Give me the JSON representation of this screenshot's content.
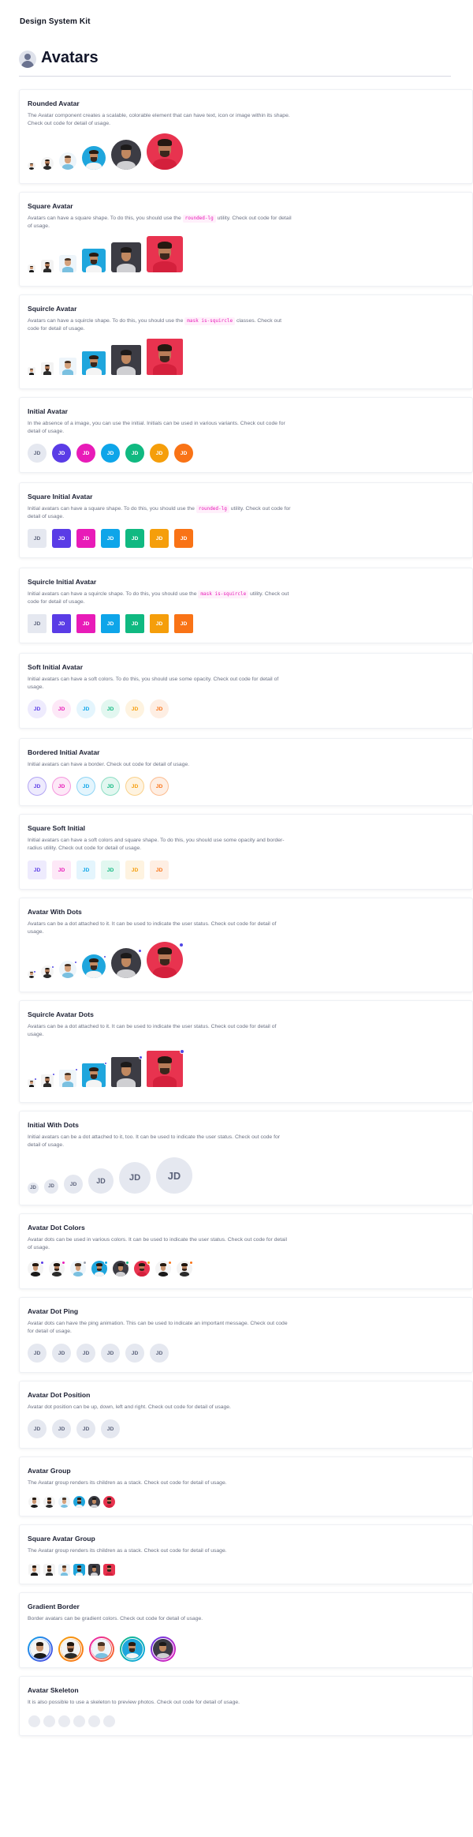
{
  "kit_title": "Design System Kit",
  "page_title": "Avatars",
  "initials": "JD",
  "colors": {
    "indigo": "#5a3ce6",
    "pink": "#e81bb8",
    "sky": "#0ea5e9",
    "green": "#10b981",
    "amber": "#f59e0b",
    "orange": "#f97316",
    "neutral": "#e5e8f0",
    "dot": "#4f46e5"
  },
  "sections": {
    "rounded": {
      "title": "Rounded Avatar",
      "desc": "The Avatar component creates a scalable, colorable element that can have text, icon or image within its shape. Check out code for detail of usage."
    },
    "square": {
      "title": "Square Avatar",
      "desc_a": "Avatars can have a square shape. To do this, you should use the",
      "tag": "rounded-lg",
      "desc_b": "utility. Check out code for detail of usage."
    },
    "squircle": {
      "title": "Squircle Avatar",
      "desc_a": "Avatars can have a squircle shape. To do this, you should use the",
      "tag": "mask is-squircle",
      "desc_b": "classes. Check out code for detail of usage."
    },
    "initial": {
      "title": "Initial Avatar",
      "desc": "In the absence of a image, you can use the initial. Initials can be used in various variants. Check out code for detail of usage."
    },
    "square_initial": {
      "title": "Square Initial Avatar",
      "desc_a": "Initial avatars can have a square shape. To do this, you should use the",
      "tag": "rounded-lg",
      "desc_b": "utility. Check out code for detail of usage."
    },
    "squircle_initial": {
      "title": "Squircle Initial Avatar",
      "desc_a": "Initial avatars can have a squircle shape. To do this, you should use the",
      "tag": "mask is-squircle",
      "desc_b": "utility. Check out code for detail of usage."
    },
    "soft_initial": {
      "title": "Soft Initial Avatar",
      "desc": "Initial avatars can have a soft colors. To do this, you should use some opacity. Check out code for detail of usage."
    },
    "bordered_initial": {
      "title": "Bordered Initial Avatar",
      "desc": "Initial avatars can have a border. Check out code for detail of usage."
    },
    "square_soft": {
      "title": "Square Soft Initial",
      "desc": "Initial avatars can have a soft colors and square shape. To do this, you should use some opacity and border-radius utility. Check out code for detail of usage."
    },
    "with_dots": {
      "title": "Avatar With Dots",
      "desc": "Avatars can be a dot attached to it. It can be used to indicate the user status. Check out code for detail of usage."
    },
    "squircle_dots": {
      "title": "Squircle Avatar Dots",
      "desc": "Avatars can be a dot attached to it. It can be used to indicate the user status. Check out code for detail of usage."
    },
    "initial_dots": {
      "title": "Initial With Dots",
      "desc": "Initial avatars can be a dot attached to it, too. It can be used to indicate the user status. Check out code for detail of usage."
    },
    "dot_colors": {
      "title": "Avatar Dot Colors",
      "desc": "Avatar dots can be used in various colors. It can be used to indicate the user status. Check out code for detail of usage."
    },
    "dot_ping": {
      "title": "Avatar Dot Ping",
      "desc": "Avatar dots can have the ping animation. This can be used to indicate an important message. Check out code for detail of usage."
    },
    "dot_position": {
      "title": "Avatar Dot Position",
      "desc": "Avatar dot position can be up, down, left and right. Check out code for detail of usage."
    },
    "group": {
      "title": "Avatar Group",
      "desc": "The Avatar group renders its children as a stack. Check out code for detail of usage."
    },
    "square_group": {
      "title": "Square Avatar Group",
      "desc": "The Avatar group renders its children as a stack. Check out code for detail of usage."
    },
    "gradient": {
      "title": "Gradient Border",
      "desc": "Border avatars can be gradient colors. Check out code for detail of usage."
    },
    "skeleton": {
      "title": "Avatar Skeleton",
      "desc": "It is also possible to use a skeleton to preview photos. Check out code for detail of usage."
    }
  }
}
